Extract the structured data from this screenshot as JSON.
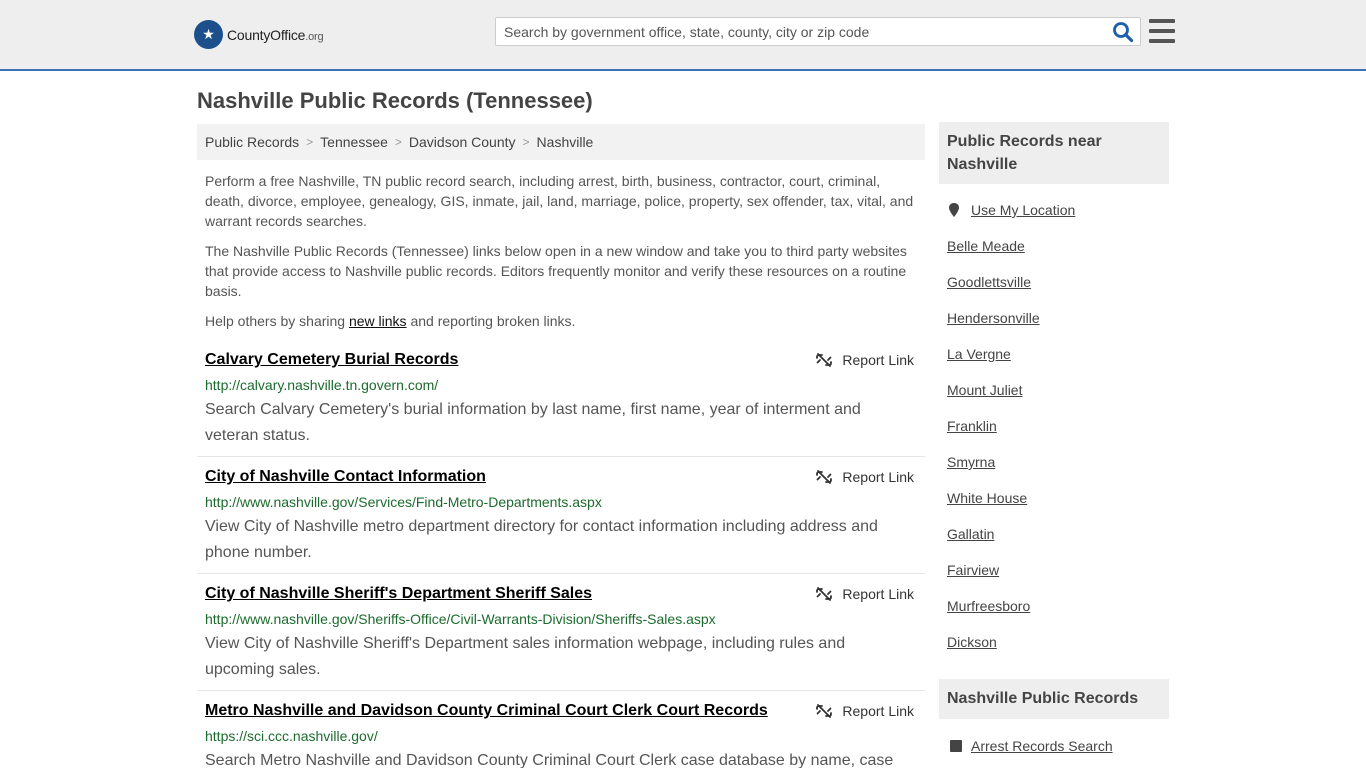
{
  "header": {
    "logo_name": "CountyOffice",
    "logo_tld": ".org",
    "search_placeholder": "Search by government office, state, county, city or zip code"
  },
  "page_title": "Nashville Public Records (Tennessee)",
  "breadcrumb": [
    "Public Records",
    "Tennessee",
    "Davidson County",
    "Nashville"
  ],
  "intro": {
    "p1": "Perform a free Nashville, TN public record search, including arrest, birth, business, contractor, court, criminal, death, divorce, employee, genealogy, GIS, inmate, jail, land, marriage, police, property, sex offender, tax, vital, and warrant records searches.",
    "p2": "The Nashville Public Records (Tennessee) links below open in a new window and take you to third party websites that provide access to Nashville public records. Editors frequently monitor and verify these resources on a routine basis.",
    "p3_before": "Help others by sharing ",
    "p3_link": "new links",
    "p3_after": " and reporting broken links."
  },
  "report_label": "Report Link",
  "records": [
    {
      "title": "Calvary Cemetery Burial Records",
      "url": "http://calvary.nashville.tn.govern.com/",
      "desc": "Search Calvary Cemetery's burial information by last name, first name, year of interment and veteran status."
    },
    {
      "title": "City of Nashville Contact Information",
      "url": "http://www.nashville.gov/Services/Find-Metro-Departments.aspx",
      "desc": "View City of Nashville metro department directory for contact information including address and phone number."
    },
    {
      "title": "City of Nashville Sheriff's Department Sheriff Sales",
      "url": "http://www.nashville.gov/Sheriffs-Office/Civil-Warrants-Division/Sheriffs-Sales.aspx",
      "desc": "View City of Nashville Sheriff's Department sales information webpage, including rules and upcoming sales."
    },
    {
      "title": "Metro Nashville and Davidson County Criminal Court Clerk Court Records",
      "url": "https://sci.ccc.nashville.gov/",
      "desc": "Search Metro Nashville and Davidson County Criminal Court Clerk case database by name, case"
    }
  ],
  "sidebar": {
    "near_title": "Public Records near Nashville",
    "use_location": "Use My Location",
    "cities": [
      "Belle Meade",
      "Goodlettsville",
      "Hendersonville",
      "La Vergne",
      "Mount Juliet",
      "Franklin",
      "Smyrna",
      "White House",
      "Gallatin",
      "Fairview",
      "Murfreesboro",
      "Dickson"
    ],
    "records_title": "Nashville Public Records",
    "records_links": [
      "Arrest Records Search"
    ]
  },
  "colors": {
    "accent_border": "#3b73b9",
    "url_green": "#1c6b2e",
    "search_icon": "#1d5fa8"
  }
}
